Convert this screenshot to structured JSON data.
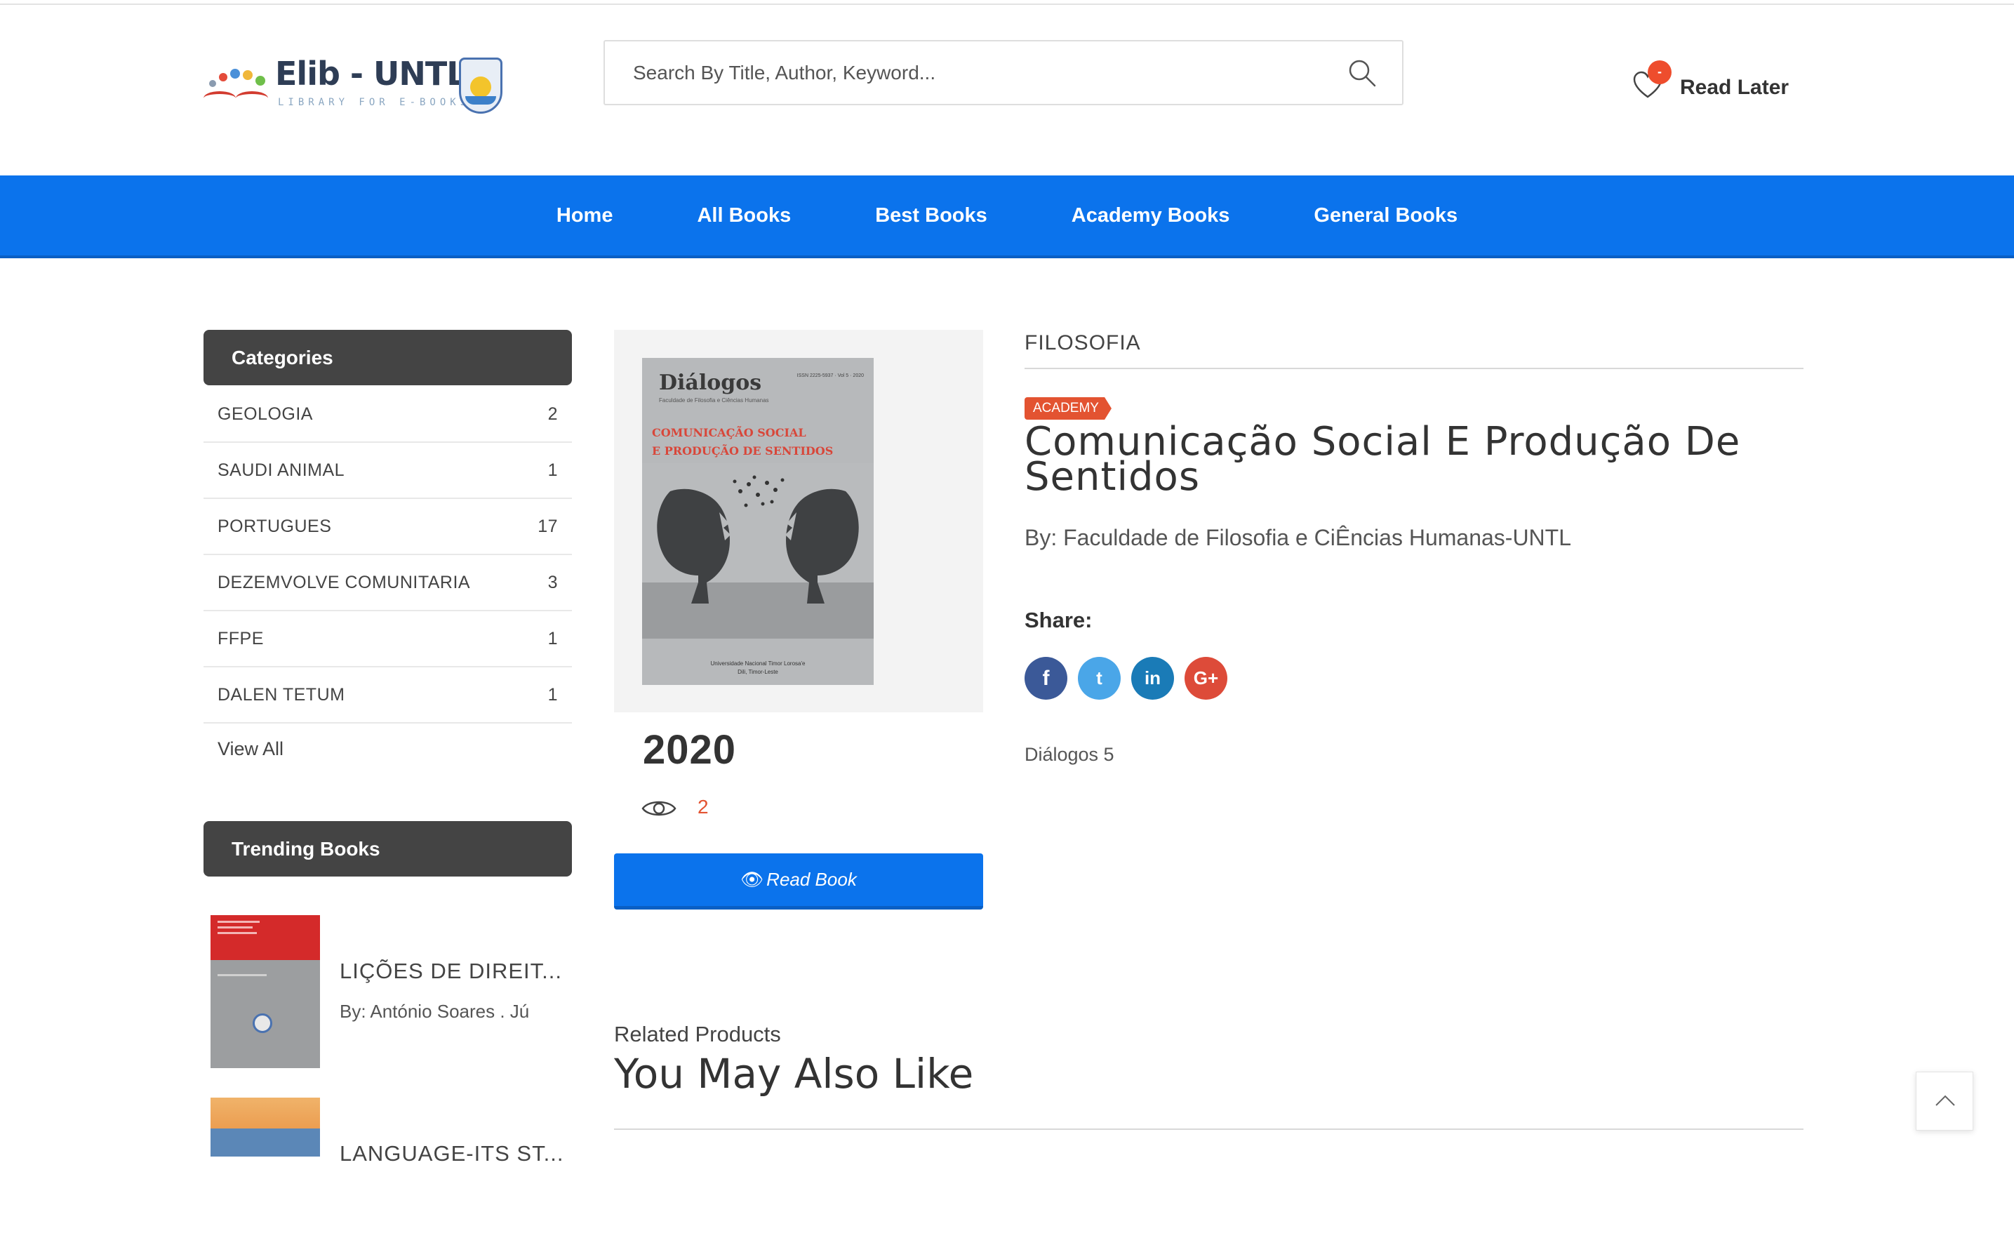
{
  "header": {
    "logo_title": "Elib - UNTL",
    "logo_sub": "LIBRARY FOR E-BOOKS",
    "search_placeholder": "Search By Title, Author, Keyword...",
    "read_later_label": "Read Later",
    "read_later_badge": "-"
  },
  "nav": {
    "items": [
      "Home",
      "All Books",
      "Best Books",
      "Academy Books",
      "General Books"
    ]
  },
  "sidebar": {
    "categories_title": "Categories",
    "categories": [
      {
        "name": "GEOLOGIA",
        "count": "2"
      },
      {
        "name": "SAUDI ANIMAL",
        "count": "1"
      },
      {
        "name": "PORTUGUES",
        "count": "17"
      },
      {
        "name": "DEZEMVOLVE COMUNITARIA",
        "count": "3"
      },
      {
        "name": "FFPE",
        "count": "1"
      },
      {
        "name": "DALEN TETUM",
        "count": "1"
      }
    ],
    "view_all": "View All",
    "trending_title": "Trending Books",
    "trending": [
      {
        "title": "LIÇÕES DE DIREIT...",
        "author": "By: António Soares . Jú"
      },
      {
        "title": "LANGUAGE-ITS ST...",
        "author": ""
      }
    ]
  },
  "product": {
    "cover": {
      "title": "Diálogos",
      "subtitle": "Faculdade de Filosofia e Ciências Humanas",
      "issn": "ISSN 2225-5937 · Vol 5 · 2020",
      "red_line1": "COMUNICAÇÃO SOCIAL",
      "red_line2": "E PRODUÇÃO DE SENTIDOS",
      "footer1": "Universidade Nacional Timor Lorosa'e",
      "footer2": "Dili, Timor-Leste"
    },
    "year": "2020",
    "views": "2",
    "read_button": "Read Book",
    "breadcrumb": "FILOSOFIA",
    "tag": "ACADEMY",
    "title": "Comunicação Social E Produção De Sentidos",
    "author": "By: Faculdade de Filosofia e CiÊncias Humanas-UNTL",
    "share_label": "Share:",
    "social": [
      {
        "name": "facebook",
        "glyph": "f",
        "color": "#3b5998"
      },
      {
        "name": "twitter",
        "glyph": "t",
        "color": "#4aa6e8"
      },
      {
        "name": "linkedin",
        "glyph": "in",
        "color": "#1a7bb7"
      },
      {
        "name": "google-plus",
        "glyph": "G+",
        "color": "#dd4b39"
      }
    ],
    "description": "Diálogos 5"
  },
  "related": {
    "subtitle": "Related Products",
    "title": "You May Also Like"
  },
  "colors": {
    "primary": "#0b73ec",
    "accent": "#e35331",
    "sidebar_header": "#444444"
  },
  "icons": [
    "search-icon",
    "heart-icon",
    "eye-icon",
    "arrow-up-icon"
  ]
}
